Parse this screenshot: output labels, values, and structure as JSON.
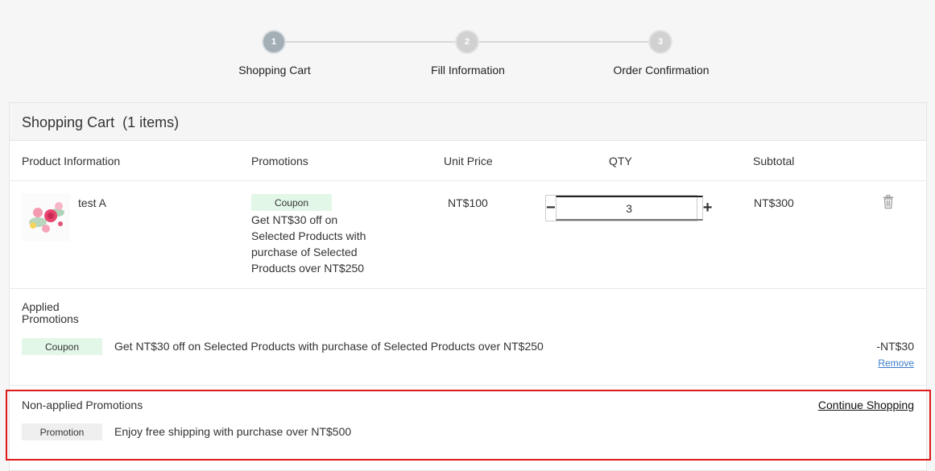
{
  "stepper": {
    "steps": [
      {
        "number": "1",
        "label": "Shopping Cart"
      },
      {
        "number": "2",
        "label": "Fill Information"
      },
      {
        "number": "3",
        "label": "Order Confirmation"
      }
    ]
  },
  "cart": {
    "title": "Shopping Cart",
    "count_label": "(1 items)",
    "columns": {
      "product": "Product Information",
      "promotions": "Promotions",
      "unit_price": "Unit Price",
      "qty": "QTY",
      "subtotal": "Subtotal"
    },
    "item": {
      "name": "test A",
      "promo_badge": "Coupon",
      "promo_text_lines": [
        "Get NT$30 off on",
        "Selected Products with",
        "purchase of Selected",
        "Products over NT$250"
      ],
      "unit_price": "NT$100",
      "qty": "3",
      "subtotal": "NT$300",
      "minus_symbol": "−",
      "plus_symbol": "+",
      "delete_icon": "trash-icon"
    }
  },
  "applied": {
    "heading_lines": [
      "Applied",
      "Promotions"
    ],
    "badge": "Coupon",
    "text": "Get NT$30 off on Selected Products with purchase of Selected Products over NT$250",
    "amount": "-NT$30",
    "remove_label": "Remove"
  },
  "non_applied": {
    "heading": "Non-applied Promotions",
    "continue_label": "Continue Shopping",
    "badge": "Promotion",
    "text": "Enjoy free shipping with purchase over NT$500"
  },
  "colors": {
    "coupon_badge_bg": "#e3f7e8",
    "promotion_badge_bg": "#efefef",
    "link_blue": "#3a7bc8",
    "highlight_red": "#e01818",
    "active_step": "#a3aeb5"
  }
}
